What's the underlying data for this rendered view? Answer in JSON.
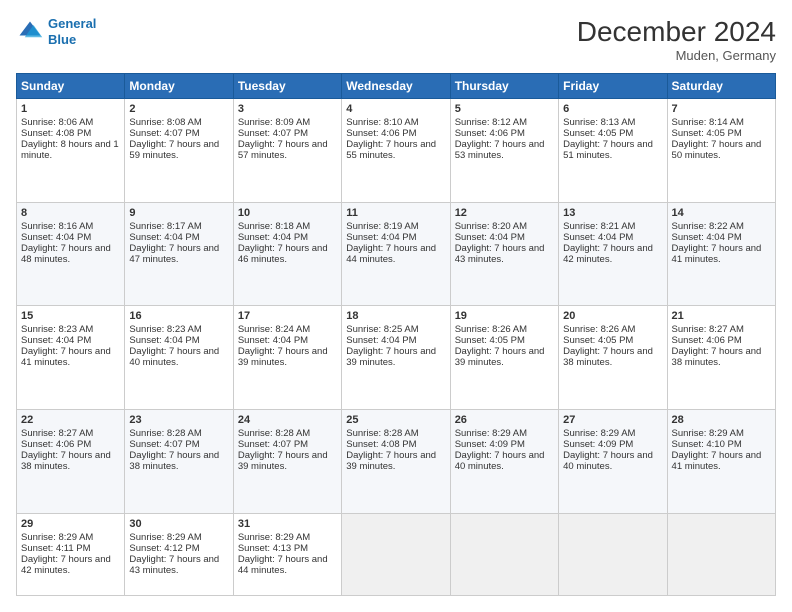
{
  "header": {
    "logo_line1": "General",
    "logo_line2": "Blue",
    "month_title": "December 2024",
    "location": "Muden, Germany"
  },
  "weekdays": [
    "Sunday",
    "Monday",
    "Tuesday",
    "Wednesday",
    "Thursday",
    "Friday",
    "Saturday"
  ],
  "weeks": [
    [
      {
        "day": "1",
        "rise": "Sunrise: 8:06 AM",
        "set": "Sunset: 4:08 PM",
        "daylight": "Daylight: 8 hours and 1 minute."
      },
      {
        "day": "2",
        "rise": "Sunrise: 8:08 AM",
        "set": "Sunset: 4:07 PM",
        "daylight": "Daylight: 7 hours and 59 minutes."
      },
      {
        "day": "3",
        "rise": "Sunrise: 8:09 AM",
        "set": "Sunset: 4:07 PM",
        "daylight": "Daylight: 7 hours and 57 minutes."
      },
      {
        "day": "4",
        "rise": "Sunrise: 8:10 AM",
        "set": "Sunset: 4:06 PM",
        "daylight": "Daylight: 7 hours and 55 minutes."
      },
      {
        "day": "5",
        "rise": "Sunrise: 8:12 AM",
        "set": "Sunset: 4:06 PM",
        "daylight": "Daylight: 7 hours and 53 minutes."
      },
      {
        "day": "6",
        "rise": "Sunrise: 8:13 AM",
        "set": "Sunset: 4:05 PM",
        "daylight": "Daylight: 7 hours and 51 minutes."
      },
      {
        "day": "7",
        "rise": "Sunrise: 8:14 AM",
        "set": "Sunset: 4:05 PM",
        "daylight": "Daylight: 7 hours and 50 minutes."
      }
    ],
    [
      {
        "day": "8",
        "rise": "Sunrise: 8:16 AM",
        "set": "Sunset: 4:04 PM",
        "daylight": "Daylight: 7 hours and 48 minutes."
      },
      {
        "day": "9",
        "rise": "Sunrise: 8:17 AM",
        "set": "Sunset: 4:04 PM",
        "daylight": "Daylight: 7 hours and 47 minutes."
      },
      {
        "day": "10",
        "rise": "Sunrise: 8:18 AM",
        "set": "Sunset: 4:04 PM",
        "daylight": "Daylight: 7 hours and 46 minutes."
      },
      {
        "day": "11",
        "rise": "Sunrise: 8:19 AM",
        "set": "Sunset: 4:04 PM",
        "daylight": "Daylight: 7 hours and 44 minutes."
      },
      {
        "day": "12",
        "rise": "Sunrise: 8:20 AM",
        "set": "Sunset: 4:04 PM",
        "daylight": "Daylight: 7 hours and 43 minutes."
      },
      {
        "day": "13",
        "rise": "Sunrise: 8:21 AM",
        "set": "Sunset: 4:04 PM",
        "daylight": "Daylight: 7 hours and 42 minutes."
      },
      {
        "day": "14",
        "rise": "Sunrise: 8:22 AM",
        "set": "Sunset: 4:04 PM",
        "daylight": "Daylight: 7 hours and 41 minutes."
      }
    ],
    [
      {
        "day": "15",
        "rise": "Sunrise: 8:23 AM",
        "set": "Sunset: 4:04 PM",
        "daylight": "Daylight: 7 hours and 41 minutes."
      },
      {
        "day": "16",
        "rise": "Sunrise: 8:23 AM",
        "set": "Sunset: 4:04 PM",
        "daylight": "Daylight: 7 hours and 40 minutes."
      },
      {
        "day": "17",
        "rise": "Sunrise: 8:24 AM",
        "set": "Sunset: 4:04 PM",
        "daylight": "Daylight: 7 hours and 39 minutes."
      },
      {
        "day": "18",
        "rise": "Sunrise: 8:25 AM",
        "set": "Sunset: 4:04 PM",
        "daylight": "Daylight: 7 hours and 39 minutes."
      },
      {
        "day": "19",
        "rise": "Sunrise: 8:26 AM",
        "set": "Sunset: 4:05 PM",
        "daylight": "Daylight: 7 hours and 39 minutes."
      },
      {
        "day": "20",
        "rise": "Sunrise: 8:26 AM",
        "set": "Sunset: 4:05 PM",
        "daylight": "Daylight: 7 hours and 38 minutes."
      },
      {
        "day": "21",
        "rise": "Sunrise: 8:27 AM",
        "set": "Sunset: 4:06 PM",
        "daylight": "Daylight: 7 hours and 38 minutes."
      }
    ],
    [
      {
        "day": "22",
        "rise": "Sunrise: 8:27 AM",
        "set": "Sunset: 4:06 PM",
        "daylight": "Daylight: 7 hours and 38 minutes."
      },
      {
        "day": "23",
        "rise": "Sunrise: 8:28 AM",
        "set": "Sunset: 4:07 PM",
        "daylight": "Daylight: 7 hours and 38 minutes."
      },
      {
        "day": "24",
        "rise": "Sunrise: 8:28 AM",
        "set": "Sunset: 4:07 PM",
        "daylight": "Daylight: 7 hours and 39 minutes."
      },
      {
        "day": "25",
        "rise": "Sunrise: 8:28 AM",
        "set": "Sunset: 4:08 PM",
        "daylight": "Daylight: 7 hours and 39 minutes."
      },
      {
        "day": "26",
        "rise": "Sunrise: 8:29 AM",
        "set": "Sunset: 4:09 PM",
        "daylight": "Daylight: 7 hours and 40 minutes."
      },
      {
        "day": "27",
        "rise": "Sunrise: 8:29 AM",
        "set": "Sunset: 4:09 PM",
        "daylight": "Daylight: 7 hours and 40 minutes."
      },
      {
        "day": "28",
        "rise": "Sunrise: 8:29 AM",
        "set": "Sunset: 4:10 PM",
        "daylight": "Daylight: 7 hours and 41 minutes."
      }
    ],
    [
      {
        "day": "29",
        "rise": "Sunrise: 8:29 AM",
        "set": "Sunset: 4:11 PM",
        "daylight": "Daylight: 7 hours and 42 minutes."
      },
      {
        "day": "30",
        "rise": "Sunrise: 8:29 AM",
        "set": "Sunset: 4:12 PM",
        "daylight": "Daylight: 7 hours and 43 minutes."
      },
      {
        "day": "31",
        "rise": "Sunrise: 8:29 AM",
        "set": "Sunset: 4:13 PM",
        "daylight": "Daylight: 7 hours and 44 minutes."
      },
      null,
      null,
      null,
      null
    ]
  ]
}
